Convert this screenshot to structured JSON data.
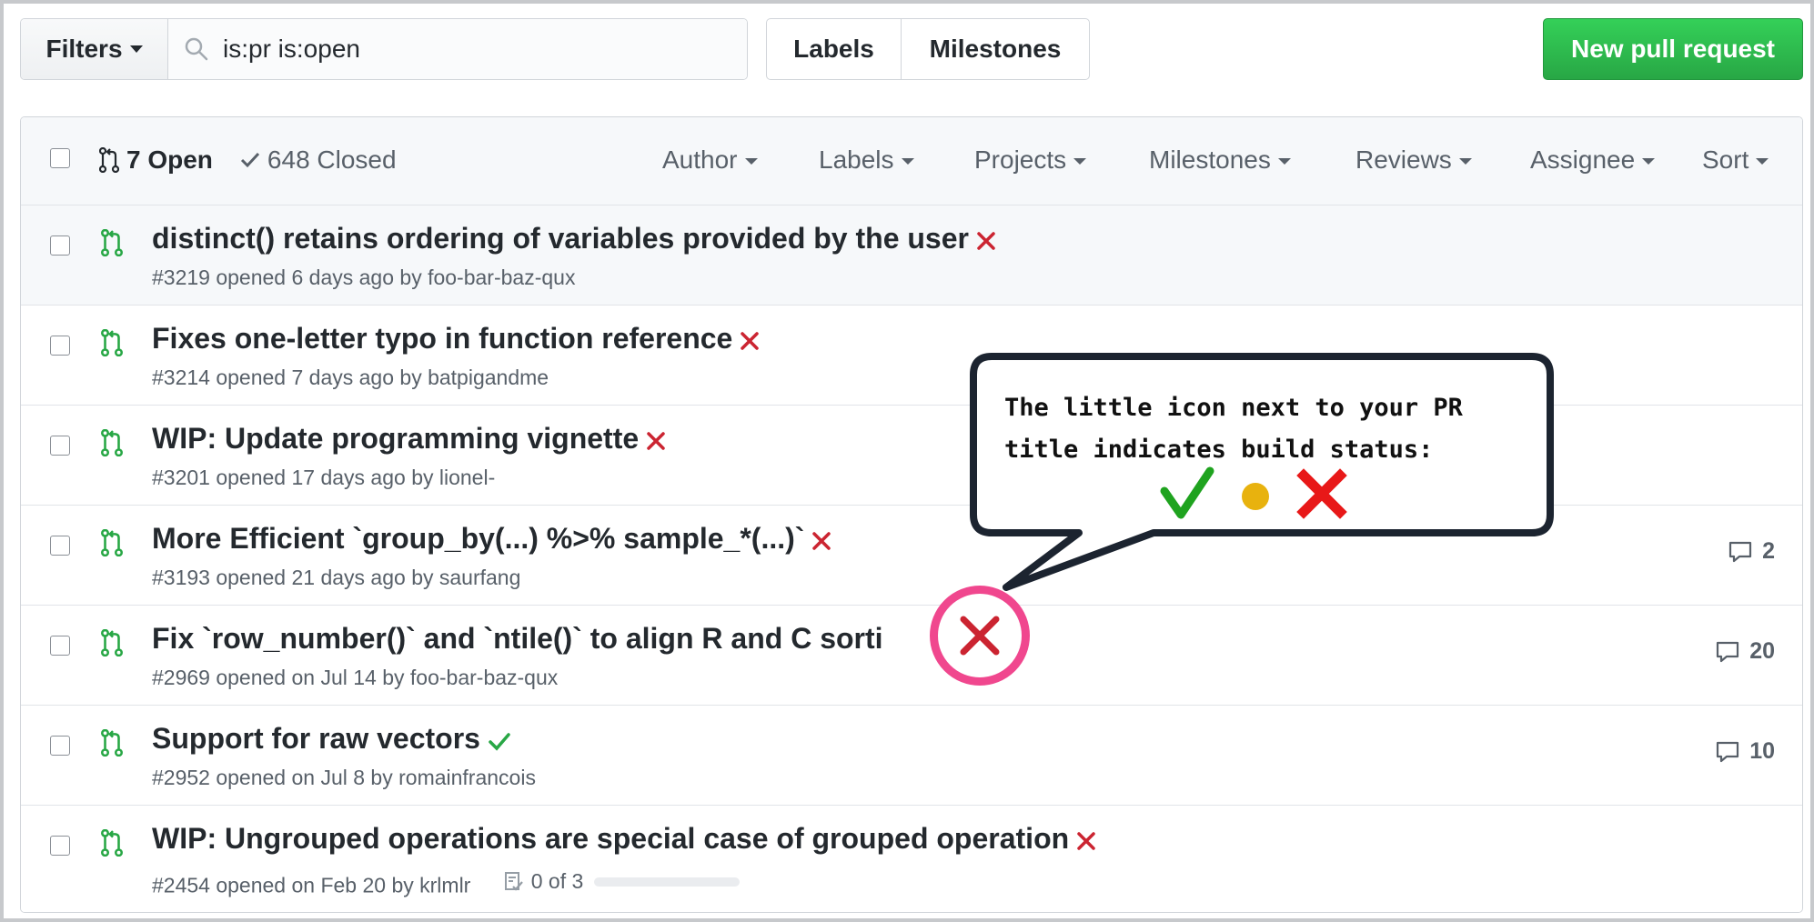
{
  "toolbar": {
    "filters_label": "Filters",
    "search_value": "is:pr is:open",
    "labels_label": "Labels",
    "milestones_label": "Milestones",
    "new_pr_label": "New pull request"
  },
  "header": {
    "open_label": "7 Open",
    "closed_label": "648 Closed",
    "menus": [
      "Author",
      "Labels",
      "Projects",
      "Milestones",
      "Reviews",
      "Assignee",
      "Sort"
    ]
  },
  "pull_requests": [
    {
      "title": "distinct() retains ordering of variables provided by the user",
      "meta": "#3219 opened 6 days ago by foo-bar-baz-qux",
      "status": "failure",
      "comments": ""
    },
    {
      "title": "Fixes one-letter typo in function reference",
      "meta": "#3214 opened 7 days ago by batpigandme",
      "status": "failure",
      "comments": ""
    },
    {
      "title": "WIP: Update programming vignette",
      "meta": "#3201 opened 17 days ago by lionel-",
      "status": "failure",
      "comments": ""
    },
    {
      "title": "More Efficient `group_by(...) %>% sample_*(...)`",
      "meta": "#3193 opened 21 days ago by saurfang",
      "status": "failure",
      "comments": "2"
    },
    {
      "title": "Fix `row_number()` and `ntile()` to align R and C sorti",
      "meta": "#2969 opened on Jul 14 by foo-bar-baz-qux",
      "status": "failure",
      "comments": "20"
    },
    {
      "title": "Support for raw vectors",
      "meta": "#2952 opened on Jul 8 by romainfrancois",
      "status": "success",
      "comments": "10"
    },
    {
      "title": "WIP: Ungrouped operations are special case of grouped operation",
      "meta": "#2454 opened on Feb 20 by krlmlr",
      "status": "failure",
      "comments": "",
      "tasks": "0 of 3",
      "tasks_progress": 0
    }
  ],
  "callout": {
    "text": "The little icon next to your PR\ntitle indicates build status:",
    "icons": [
      "check-icon",
      "pending-dot-icon",
      "cross-icon"
    ]
  },
  "colors": {
    "green": "#28a745",
    "red": "#cb2431",
    "pending": "#dbab09",
    "highlight": "#f0478e"
  }
}
